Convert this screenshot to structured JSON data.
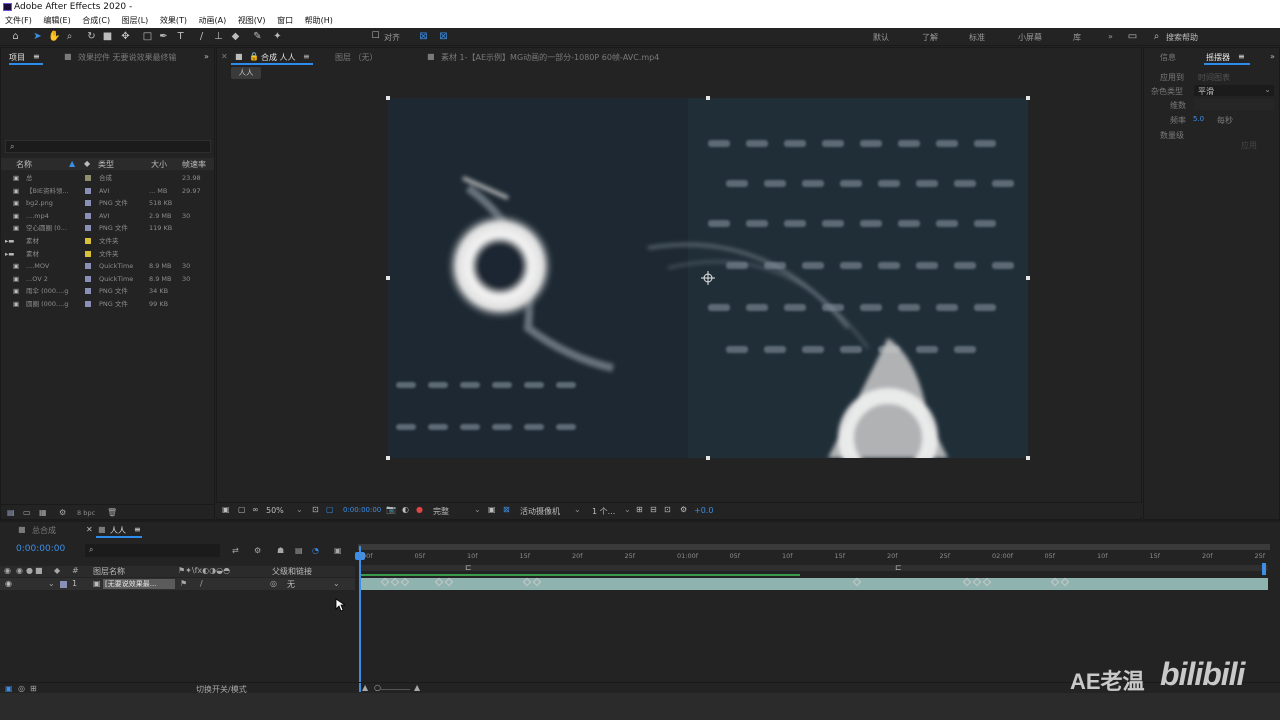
{
  "window": {
    "title": "Adobe After Effects 2020 -"
  },
  "menu": [
    "文件(F)",
    "编辑(E)",
    "合成(C)",
    "图层(L)",
    "效果(T)",
    "动画(A)",
    "视图(V)",
    "窗口",
    "帮助(H)"
  ],
  "toolbar": {
    "align_label": "对齐",
    "workspaces": [
      "默认",
      "了解",
      "标准",
      "小屏幕",
      "库"
    ],
    "search_placeholder": "搜索帮助"
  },
  "project_panel": {
    "tab_label": "项目",
    "effects_tab": "效果控件 无要说效果最终输",
    "columns": [
      "名称",
      "类型",
      "大小",
      "帧速率"
    ],
    "items": [
      {
        "name": "总",
        "type": "合成",
        "size": "",
        "fps": "23.98",
        "color": "#8f8f6e"
      },
      {
        "name": "【BIE资料领...",
        "type": "AVI",
        "size": "... MB",
        "fps": "29.97",
        "color": "#8a8fb5"
      },
      {
        "name": "bg2.png",
        "type": "PNG 文件",
        "size": "518 KB",
        "fps": "",
        "color": "#8a8fb5"
      },
      {
        "name": "....mp4",
        "type": "AVI",
        "size": "2.9 MB",
        "fps": "30",
        "color": "#8a8fb5"
      },
      {
        "name": "空心圆圈 (0...",
        "type": "PNG 文件",
        "size": "119 KB",
        "fps": "",
        "color": "#8a8fb5"
      },
      {
        "name": "素材",
        "type": "文件夹",
        "size": "",
        "fps": "",
        "color": "#d8c23a"
      },
      {
        "name": "素材",
        "type": "文件夹",
        "size": "",
        "fps": "",
        "color": "#d8c23a"
      },
      {
        "name": "....MOV",
        "type": "QuickTime",
        "size": "8.9 MB",
        "fps": "30",
        "color": "#8a8fb5"
      },
      {
        "name": "...OV 2",
        "type": "QuickTime",
        "size": "8.9 MB",
        "fps": "30",
        "color": "#8a8fb5"
      },
      {
        "name": "雨伞 (000....g",
        "type": "PNG 文件",
        "size": "34 KB",
        "fps": "",
        "color": "#8a8fb5"
      },
      {
        "name": "圆圈 (000....g",
        "type": "PNG 文件",
        "size": "99 KB",
        "fps": "",
        "color": "#8a8fb5"
      }
    ],
    "bpc": "8 bpc"
  },
  "composition": {
    "tab_label": "合成 人人",
    "layer_tab": "图层 （无）",
    "footage_tab": "素材 1-【AE示例】MG动画的一部分-1080P 60帧-AVC.mp4",
    "breadcrumb": "人人",
    "zoom": "50%",
    "timecode": "0:00:00:00",
    "resolution": "完整",
    "camera": "活动摄像机",
    "views": "1 个...",
    "exposure": "+0.0"
  },
  "right_panel": {
    "tabs": [
      "信息",
      "摇摆器"
    ],
    "apply_to_label": "应用到",
    "apply_to_value": "时间图表",
    "noise_type_label": "杂色类型",
    "noise_type_value": "平滑",
    "dimension_label": "维数",
    "frequency_label": "频率",
    "frequency_value": "5.0",
    "per_second": "每秒",
    "magnitude_label": "数量级",
    "apply_button": "应用"
  },
  "timeline": {
    "tabs": [
      "总合成",
      "人人"
    ],
    "timecode": "0:00:00:00",
    "search_placeholder": "",
    "columns": [
      "图层名称",
      "父级和链接"
    ],
    "layer": {
      "index": "1",
      "name": "[无要说效果最...",
      "parent": "无"
    },
    "ruler": [
      "00f",
      "05f",
      "10f",
      "15f",
      "20f",
      "25f",
      "01:00f",
      "05f",
      "10f",
      "15f",
      "20f",
      "25f",
      "02:00f",
      "05f",
      "10f",
      "15f",
      "20f",
      "25f"
    ],
    "toggle_label": "切换开关/模式"
  },
  "watermark": {
    "text": "AE老温",
    "brand": "bilibili"
  }
}
